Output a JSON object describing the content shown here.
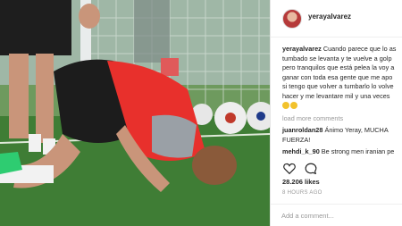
{
  "post": {
    "username": "yerayalvarez",
    "caption_user": "yerayalvarez",
    "caption_lines": [
      " Cuando parece que lo as",
      "tumbado se levanta y te vuelve a golp",
      "pero tranquilos que está pelea la voy a",
      "ganar con toda esa gente que me apo",
      "si tengo que volver a tumbarlo lo volve",
      "hacer y me levantare mil y una veces"
    ],
    "load_more": "load more comments",
    "comments": [
      {
        "user": "juanroldan28",
        "text": " Ánimo Yeray, MUCHA",
        "text2": "FUERZA!"
      },
      {
        "user": "mehdi_k_90",
        "text": " Be strong men iranian pe"
      }
    ],
    "likes": "28.206 likes",
    "time": "8 HOURS AGO",
    "add_comment_placeholder": "Add a comment..."
  },
  "icons": {
    "like": "heart-icon",
    "comment": "comment-icon",
    "more": "more-icon"
  },
  "colors": {
    "text": "#262626",
    "muted": "#999999",
    "border": "#efefef"
  }
}
